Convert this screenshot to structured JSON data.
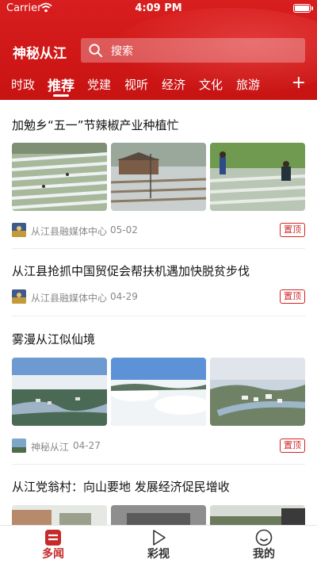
{
  "status_bar": {
    "carrier": "Carrier",
    "time": "4:09 PM"
  },
  "header": {
    "app_title": "神秘从江",
    "search_placeholder": "搜索",
    "tabs": [
      {
        "label": "时政"
      },
      {
        "label": "推荐",
        "active": true
      },
      {
        "label": "党建"
      },
      {
        "label": "视听"
      },
      {
        "label": "经济"
      },
      {
        "label": "文化"
      },
      {
        "label": "旅游"
      }
    ],
    "add_tab_label": "+"
  },
  "feed": [
    {
      "title": "加勉乡“五一”节辣椒产业种植忙",
      "source": "从江县融媒体中心",
      "date": "05-02",
      "pin": "置顶",
      "has_images": true
    },
    {
      "title": "从江县抢抓中国贸促会帮扶机遇加快脱贫步伐",
      "source": "从江县融媒体中心",
      "date": "04-29",
      "pin": "置顶",
      "has_images": false
    },
    {
      "title": "雾漫从江似仙境",
      "source": "神秘从江",
      "date": "04-27",
      "pin": "置顶",
      "has_images": true
    },
    {
      "title": "从江党翁村：向山要地  发展经济促民增收",
      "has_images": true
    }
  ],
  "bottom_nav": [
    {
      "label": "多闻",
      "icon": "news-icon",
      "active": true
    },
    {
      "label": "彩视",
      "icon": "play-icon"
    },
    {
      "label": "我的",
      "icon": "smiley-icon"
    }
  ],
  "colors": {
    "brand_red": "#d81e1e",
    "pin_red": "#d32626",
    "active_nav": "#c62a2a"
  }
}
